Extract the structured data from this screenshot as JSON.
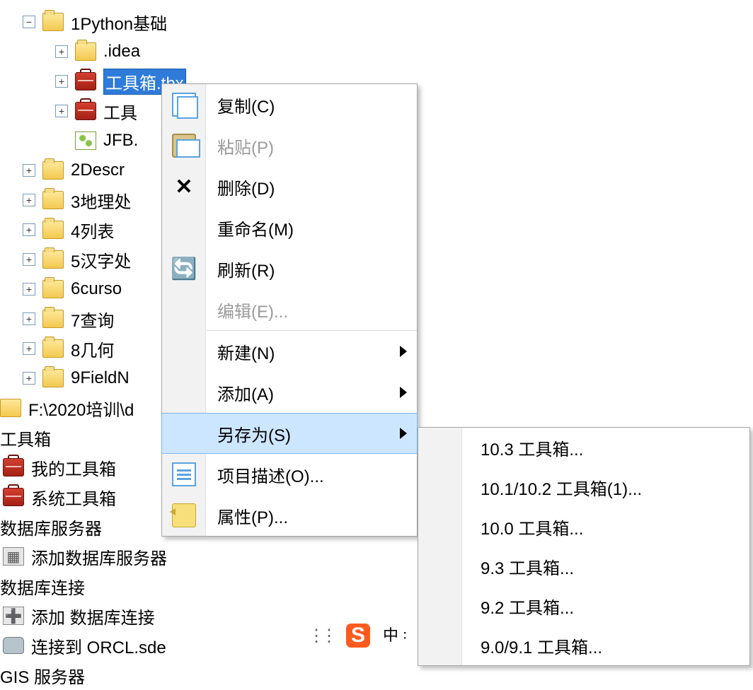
{
  "tree": {
    "root": {
      "label": "1Python基础"
    },
    "children": [
      {
        "label": ".idea"
      },
      {
        "label": "工具箱.tbx",
        "selected": true
      },
      {
        "label": "工具"
      },
      {
        "label": "JFB."
      },
      {
        "label": "2Descr"
      },
      {
        "label": "3地理处"
      },
      {
        "label": "4列表"
      },
      {
        "label": "5汉字处"
      },
      {
        "label": "6curso"
      },
      {
        "label": "7查询"
      },
      {
        "label": "8几何"
      },
      {
        "label": "9FieldN"
      }
    ],
    "drive": {
      "label": "F:\\2020培训\\d"
    },
    "toolboxHeader": "工具箱",
    "myToolbox": "我的工具箱",
    "sysToolbox": "系统工具箱",
    "dbServerHeader": "数据库服务器",
    "addDbServer": "添加数据库服务器",
    "dbConnHeader": "数据库连接",
    "addDbConn": "添加 数据库连接",
    "orcl": "连接到 ORCL.sde",
    "gis": "GIS 服务器"
  },
  "menu": {
    "copy": "复制(C)",
    "paste": "粘贴(P)",
    "delete": "删除(D)",
    "rename": "重命名(M)",
    "refresh": "刷新(R)",
    "edit": "编辑(E)...",
    "new": "新建(N)",
    "add": "添加(A)",
    "saveAs": "另存为(S)",
    "desc": "项目描述(O)...",
    "props": "属性(P)..."
  },
  "submenu": [
    "10.3 工具箱...",
    "10.1/10.2 工具箱(1)...",
    "10.0 工具箱...",
    "9.3 工具箱...",
    "9.2 工具箱...",
    "9.0/9.1 工具箱..."
  ],
  "ime": {
    "logo": "S",
    "mode": "中 ꞉"
  }
}
